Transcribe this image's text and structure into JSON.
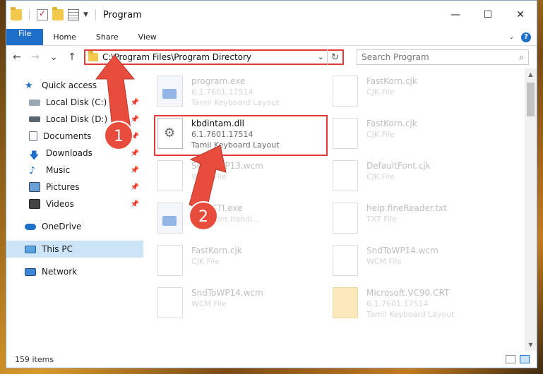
{
  "window": {
    "title": "Program",
    "controls": {
      "minimize": "—",
      "maximize": "☐",
      "close": "✕"
    }
  },
  "ribbon": {
    "tabs": [
      "File",
      "Home",
      "Share",
      "View"
    ],
    "help": "?"
  },
  "address": {
    "path": "C:\\Program Files\\Program Directory",
    "search_placeholder": "Search Program"
  },
  "sidebar": {
    "quick_access": "Quick access",
    "items": [
      {
        "label": "Local Disk (C:)",
        "icon": "drive-icon",
        "pinned": true
      },
      {
        "label": "Local Disk (D:)",
        "icon": "drive-icon",
        "pinned": true
      },
      {
        "label": "Documents",
        "icon": "documents-icon",
        "pinned": true
      },
      {
        "label": "Downloads",
        "icon": "downloads-icon",
        "pinned": true
      },
      {
        "label": "Music",
        "icon": "music-icon",
        "pinned": true
      },
      {
        "label": "Pictures",
        "icon": "pictures-icon",
        "pinned": true
      },
      {
        "label": "Videos",
        "icon": "videos-icon",
        "pinned": true
      }
    ],
    "onedrive": "OneDrive",
    "thispc": "This PC",
    "network": "Network"
  },
  "files": [
    {
      "name": "program.exe",
      "line1": "6.1.7601.17514",
      "line2": "Tamil Keyboard Layout",
      "kind": "exe",
      "faded": true
    },
    {
      "name": "FastKorn.cjk",
      "line1": "CJK File",
      "line2": "",
      "kind": "doc",
      "faded": true
    },
    {
      "name": "kbdintam.dll",
      "line1": "6.1.7601.17514",
      "line2": "Tamil Keyboard Layout",
      "kind": "gear",
      "faded": false
    },
    {
      "name": "FastKorn.cjk",
      "line1": "CJK File",
      "line2": "",
      "kind": "doc",
      "faded": true
    },
    {
      "name": "SndToWP13.wcm",
      "line1": "WCM File",
      "line2": "",
      "kind": "doc",
      "faded": true
    },
    {
      "name": "DefaultFont.cjk",
      "line1": "CJK File",
      "line2": "",
      "kind": "doc",
      "faded": true
    },
    {
      "name": "SyncSTI.exe",
      "line1": "STI event handl...",
      "line2": "",
      "kind": "exe",
      "faded": true
    },
    {
      "name": "help.fineReader.txt",
      "line1": "TXT File",
      "line2": "",
      "kind": "doc",
      "faded": true
    },
    {
      "name": "FastKorn.cjk",
      "line1": "CJK File",
      "line2": "",
      "kind": "doc",
      "faded": true
    },
    {
      "name": "SndToWP14.wcm",
      "line1": "WCM File",
      "line2": "",
      "kind": "doc",
      "faded": true
    },
    {
      "name": "SndToWP14.wcm",
      "line1": "WCM File",
      "line2": "",
      "kind": "doc",
      "faded": true
    },
    {
      "name": "Microsoft.VC90.CRT",
      "line1": "6.1.7601.17514",
      "line2": "Tamil Keyboard Layout",
      "kind": "folder",
      "faded": true
    }
  ],
  "status": {
    "items": "159 items"
  },
  "annotations": {
    "step1": "1",
    "step2": "2",
    "arrow_color": "#e84c3d"
  }
}
